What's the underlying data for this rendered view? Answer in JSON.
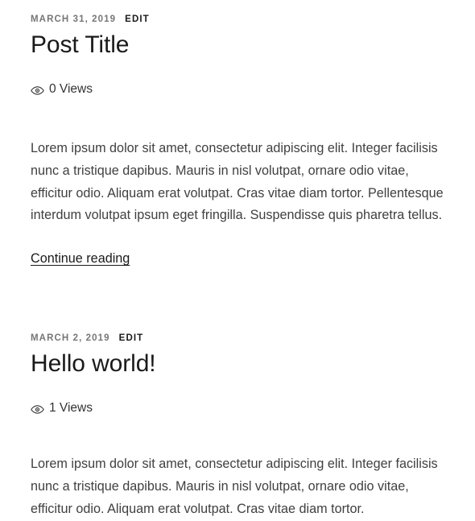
{
  "site": {
    "accent_color": "#1a1a1a",
    "meta_color": "#767676",
    "body_color": "#404040",
    "background": "#ffffff"
  },
  "posts": [
    {
      "date": "MARCH 31, 2019",
      "edit_label": "EDIT",
      "title": "Post Title",
      "views_icon": "eye-icon",
      "views_text": "0 Views",
      "excerpt": "Lorem ipsum dolor sit amet, consectetur adipiscing elit. Integer facilisis nunc a tristique dapibus. Mauris in nisl volutpat, ornare odio vitae, efficitur odio. Aliquam erat volutpat. Cras vitae diam tortor. Pellentesque interdum volutpat ipsum eget fringilla. Suspendisse quis pharetra tellus.",
      "more_label": "Continue reading"
    },
    {
      "date": "MARCH 2, 2019",
      "edit_label": "EDIT",
      "title": "Hello world!",
      "views_icon": "eye-icon",
      "views_text": "1 Views",
      "excerpt": "Lorem ipsum dolor sit amet, consectetur adipiscing elit. Integer facilisis nunc a tristique dapibus. Mauris in nisl volutpat, ornare odio vitae, efficitur odio. Aliquam erat volutpat. Cras vitae diam tortor."
    }
  ]
}
